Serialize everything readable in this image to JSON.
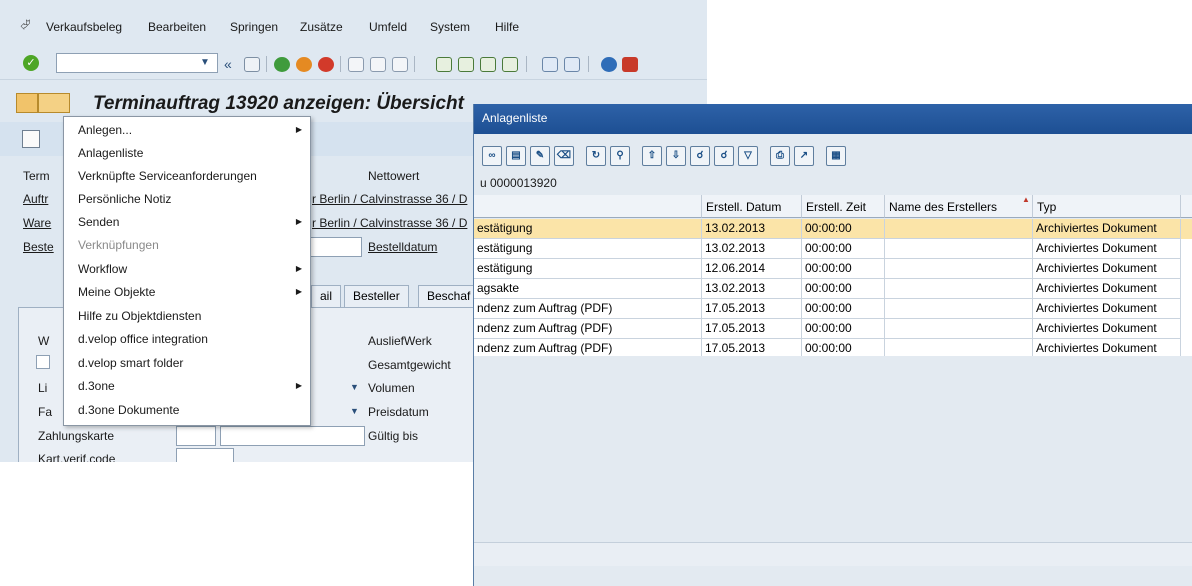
{
  "menubar": {
    "items": [
      {
        "label": "Verkaufsbeleg"
      },
      {
        "label": "Bearbeiten"
      },
      {
        "label": "Springen"
      },
      {
        "label": "Zusätze"
      },
      {
        "label": "Umfeld"
      },
      {
        "label": "System"
      },
      {
        "label": "Hilfe"
      }
    ]
  },
  "toolbar": {
    "back_glyph": "«"
  },
  "title": {
    "text": "Terminauftrag 13920 anzeigen: Übersicht"
  },
  "form": {
    "nettowert_label": "Nettowert",
    "row_labels": [
      "Term",
      "Auftr",
      "Ware",
      "Beste"
    ],
    "auftr_value": "r Berlin / Calvinstrasse 36 / D",
    "ware_value": "r Berlin / Calvinstrasse 36 / D",
    "bestelldatum_label": "Bestelldatum",
    "ausliefwerk_label": "AusliefWerk",
    "gesamtgewicht_label": "Gesamtgewicht",
    "volumen_label": "Volumen",
    "preisdatum_label": "Preisdatum",
    "zahlungskarte_label": "Zahlungskarte",
    "gueltig_bis_label": "Gültig bis",
    "kart_verif_label": "Kart.verif.code",
    "left_labels": [
      "W",
      "Li",
      "Fa"
    ]
  },
  "tabs": [
    {
      "label": "ail"
    },
    {
      "label": "Besteller"
    },
    {
      "label": "Beschaf"
    }
  ],
  "context_menu": {
    "items": [
      {
        "label": "Anlegen...",
        "submenu": true,
        "disabled": false
      },
      {
        "label": "Anlagenliste",
        "submenu": false,
        "disabled": false
      },
      {
        "label": "Verknüpfte Serviceanforderungen",
        "submenu": false,
        "disabled": false
      },
      {
        "label": "Persönliche Notiz",
        "submenu": false,
        "disabled": false
      },
      {
        "label": "Senden",
        "submenu": true,
        "disabled": false
      },
      {
        "label": "Verknüpfungen",
        "submenu": false,
        "disabled": true
      },
      {
        "label": "Workflow",
        "submenu": true,
        "disabled": false
      },
      {
        "label": "Meine Objekte",
        "submenu": true,
        "disabled": false
      },
      {
        "label": "Hilfe zu Objektdiensten",
        "submenu": false,
        "disabled": false
      },
      {
        "label": "d.velop office integration",
        "submenu": false,
        "disabled": false
      },
      {
        "label": "d.velop smart folder",
        "submenu": false,
        "disabled": false
      },
      {
        "label": "d.3one",
        "submenu": true,
        "disabled": false
      },
      {
        "label": "d.3one Dokumente",
        "submenu": false,
        "disabled": false
      }
    ]
  },
  "attachment_list": {
    "title": "Anlagenliste",
    "subtitle": "u 0000013920",
    "columns": [
      "",
      "Erstell. Datum",
      "Erstell. Zeit",
      "Name des Erstellers",
      "Typ"
    ],
    "rows": [
      {
        "title": "estätigung",
        "date": "13.02.2013",
        "time": "00:00:00",
        "creator": "",
        "type": "Archiviertes Dokument",
        "selected": true
      },
      {
        "title": "estätigung",
        "date": "13.02.2013",
        "time": "00:00:00",
        "creator": "",
        "type": "Archiviertes Dokument",
        "selected": false
      },
      {
        "title": "estätigung",
        "date": "12.06.2014",
        "time": "00:00:00",
        "creator": "",
        "type": "Archiviertes Dokument",
        "selected": false
      },
      {
        "title": "agsakte",
        "date": "13.02.2013",
        "time": "00:00:00",
        "creator": "",
        "type": "Archiviertes Dokument",
        "selected": false
      },
      {
        "title": "ndenz zum Auftrag (PDF)",
        "date": "17.05.2013",
        "time": "00:00:00",
        "creator": "",
        "type": "Archiviertes Dokument",
        "selected": false
      },
      {
        "title": "ndenz zum Auftrag (PDF)",
        "date": "17.05.2013",
        "time": "00:00:00",
        "creator": "",
        "type": "Archiviertes Dokument",
        "selected": false
      },
      {
        "title": "ndenz zum Auftrag (PDF)",
        "date": "17.05.2013",
        "time": "00:00:00",
        "creator": "",
        "type": "Archiviertes Dokument",
        "selected": false
      }
    ]
  },
  "colors": {
    "selected_row": "#fbe4a8",
    "title_bar": "#2558a0",
    "window_bg": "#dfe8f1"
  }
}
